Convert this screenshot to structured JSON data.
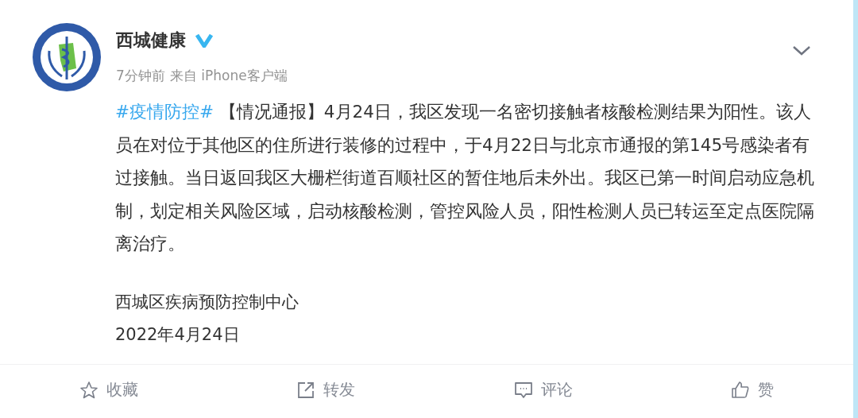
{
  "post": {
    "author": "西城健康",
    "verified": true,
    "time": "7分钟前",
    "source": "来自 iPhone客户端",
    "hashtag": "#疫情防控#",
    "body": " 【情况通报】4月24日，我区发现一名密切接触者核酸检测结果为阳性。该人员在对位于其他区的住所进行装修的过程中，于4月22日与北京市通报的第145号感染者有过接触。当日返回我区大栅栏街道百顺社区的暂住地后未外出。我区已第一时间启动应急机制，划定相关风险区域，启动核酸检测，管控风险人员，阳性检测人员已转运至定点医院隔离治疗。",
    "signature": [
      "西城区疾病预防控制中心",
      "2022年4月24日"
    ]
  },
  "actions": [
    {
      "kind": "favorite",
      "label": "收藏"
    },
    {
      "kind": "repost",
      "label": "转发"
    },
    {
      "kind": "comment",
      "label": "评论"
    },
    {
      "kind": "like",
      "label": "赞"
    }
  ]
}
